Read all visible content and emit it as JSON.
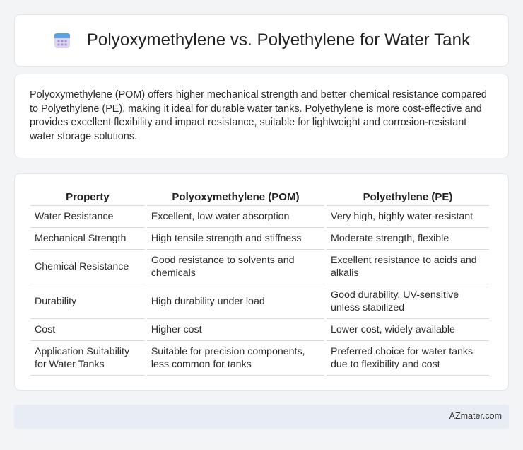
{
  "header": {
    "title": "Polyoxymethylene vs. Polyethylene for Water Tank",
    "icon": "calendar-icon"
  },
  "summary": "Polyoxymethylene (POM) offers higher mechanical strength and better chemical resistance compared to Polyethylene (PE), making it ideal for durable water tanks. Polyethylene is more cost-effective and provides excellent flexibility and impact resistance, suitable for lightweight and corrosion-resistant water storage solutions.",
  "table": {
    "headers": [
      "Property",
      "Polyoxymethylene (POM)",
      "Polyethylene (PE)"
    ],
    "rows": [
      [
        "Water Resistance",
        "Excellent, low water absorption",
        "Very high, highly water-resistant"
      ],
      [
        "Mechanical Strength",
        "High tensile strength and stiffness",
        "Moderate strength, flexible"
      ],
      [
        "Chemical Resistance",
        "Good resistance to solvents and chemicals",
        "Excellent resistance to acids and alkalis"
      ],
      [
        "Durability",
        "High durability under load",
        "Good durability, UV-sensitive unless stabilized"
      ],
      [
        "Cost",
        "Higher cost",
        "Lower cost, widely available"
      ],
      [
        "Application Suitability for Water Tanks",
        "Suitable for precision components, less common for tanks",
        "Preferred choice for water tanks due to flexibility and cost"
      ]
    ]
  },
  "footer": {
    "text": "AZmater.com"
  }
}
